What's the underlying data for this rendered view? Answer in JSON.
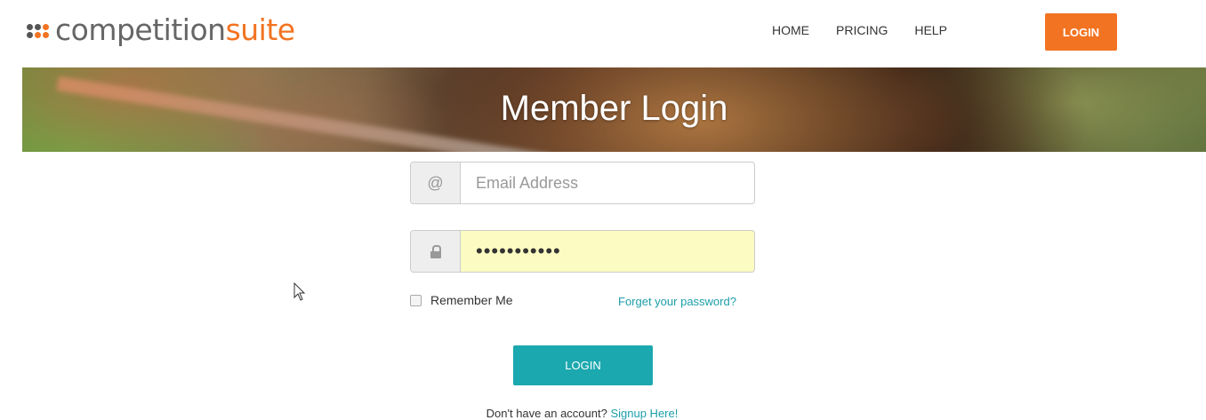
{
  "brand": {
    "logo_part1": "competition",
    "logo_part2": "suite",
    "accent_color": "#f27321",
    "teal_color": "#1ba8ae"
  },
  "nav": {
    "items": [
      {
        "label": "HOME"
      },
      {
        "label": "PRICING"
      },
      {
        "label": "HELP"
      }
    ],
    "login_label": "LOGIN"
  },
  "banner": {
    "title": "Member Login"
  },
  "form": {
    "email": {
      "icon": "at-sign-icon",
      "icon_glyph": "@",
      "placeholder": "Email Address",
      "value": ""
    },
    "password": {
      "icon": "lock-icon",
      "value": "•••••••••••"
    },
    "remember_label": "Remember Me",
    "remember_checked": false,
    "forgot_link": "Forget your password?",
    "submit_label": "LOGIN",
    "signup_prompt": "Don't have an account?",
    "signup_link": "Signup Here!"
  }
}
